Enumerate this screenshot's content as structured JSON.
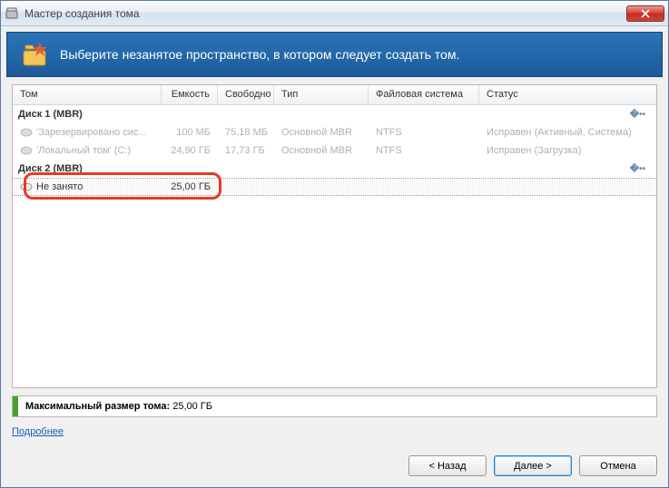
{
  "titlebar": {
    "text": "Мастер создания тома"
  },
  "header": {
    "text": "Выберите незанятое пространство, в котором следует создать том."
  },
  "columns": {
    "volume": "Том",
    "capacity": "Емкость",
    "free": "Свободно",
    "type": "Тип",
    "filesystem": "Файловая система",
    "status": "Статус"
  },
  "groups": [
    {
      "label": "Диск 1 (MBR)",
      "rows": [
        {
          "volume": "'Зарезервировано сис...",
          "capacity": "100 МБ",
          "free": "75,18 МБ",
          "type": "Основной MBR",
          "fs": "NTFS",
          "status": "Исправен (Активный, Система)"
        },
        {
          "volume": "'Локальный том' (C:)",
          "capacity": "24,90 ГБ",
          "free": "17,73 ГБ",
          "type": "Основной MBR",
          "fs": "NTFS",
          "status": "Исправен (Загрузка)"
        }
      ]
    },
    {
      "label": "Диск 2 (MBR)",
      "rows": [
        {
          "volume": "Не занято",
          "capacity": "25,00 ГБ",
          "free": "",
          "type": "",
          "fs": "",
          "status": "",
          "selected": true
        }
      ]
    }
  ],
  "summary": {
    "label": "Максимальный размер тома:",
    "value": "25,00 ГБ"
  },
  "linkMore": "Подробнее",
  "buttons": {
    "back": "< Назад",
    "next": "Далее >",
    "cancel": "Отмена"
  }
}
